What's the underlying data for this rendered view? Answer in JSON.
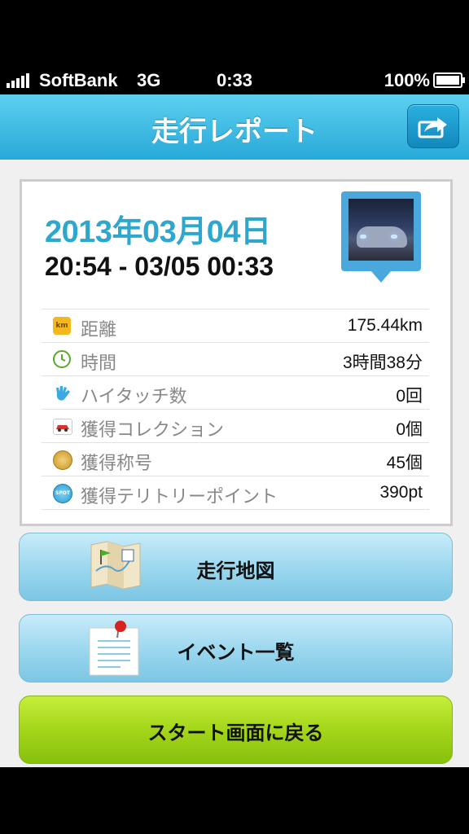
{
  "status_bar": {
    "carrier": "SoftBank",
    "network": "3G",
    "time": "0:33",
    "battery": "100%"
  },
  "header": {
    "title": "走行レポート",
    "share_icon": "share-icon"
  },
  "report": {
    "date": "2013年03月04日",
    "time_range": "20:54 - 03/05 00:33",
    "stats": [
      {
        "label": "距離",
        "value": "175.44km",
        "icon": "km-icon"
      },
      {
        "label": "時間",
        "value": "3時間38分",
        "icon": "clock-icon"
      },
      {
        "label": "ハイタッチ数",
        "value": "0回",
        "icon": "high-touch-icon"
      },
      {
        "label": "獲得コレクション",
        "value": "0個",
        "icon": "car-collection-icon"
      },
      {
        "label": "獲得称号",
        "value": "45個",
        "icon": "title-medal-icon"
      },
      {
        "label": "獲得テリトリーポイント",
        "value": "390pt",
        "icon": "spot-icon"
      }
    ]
  },
  "buttons": {
    "map": "走行地図",
    "events": "イベント一覧",
    "start": "スタート画面に戻る"
  },
  "colors": {
    "header": "#27a9d8",
    "accent": "#2ea7cf",
    "start_button": "#a4d61a"
  }
}
